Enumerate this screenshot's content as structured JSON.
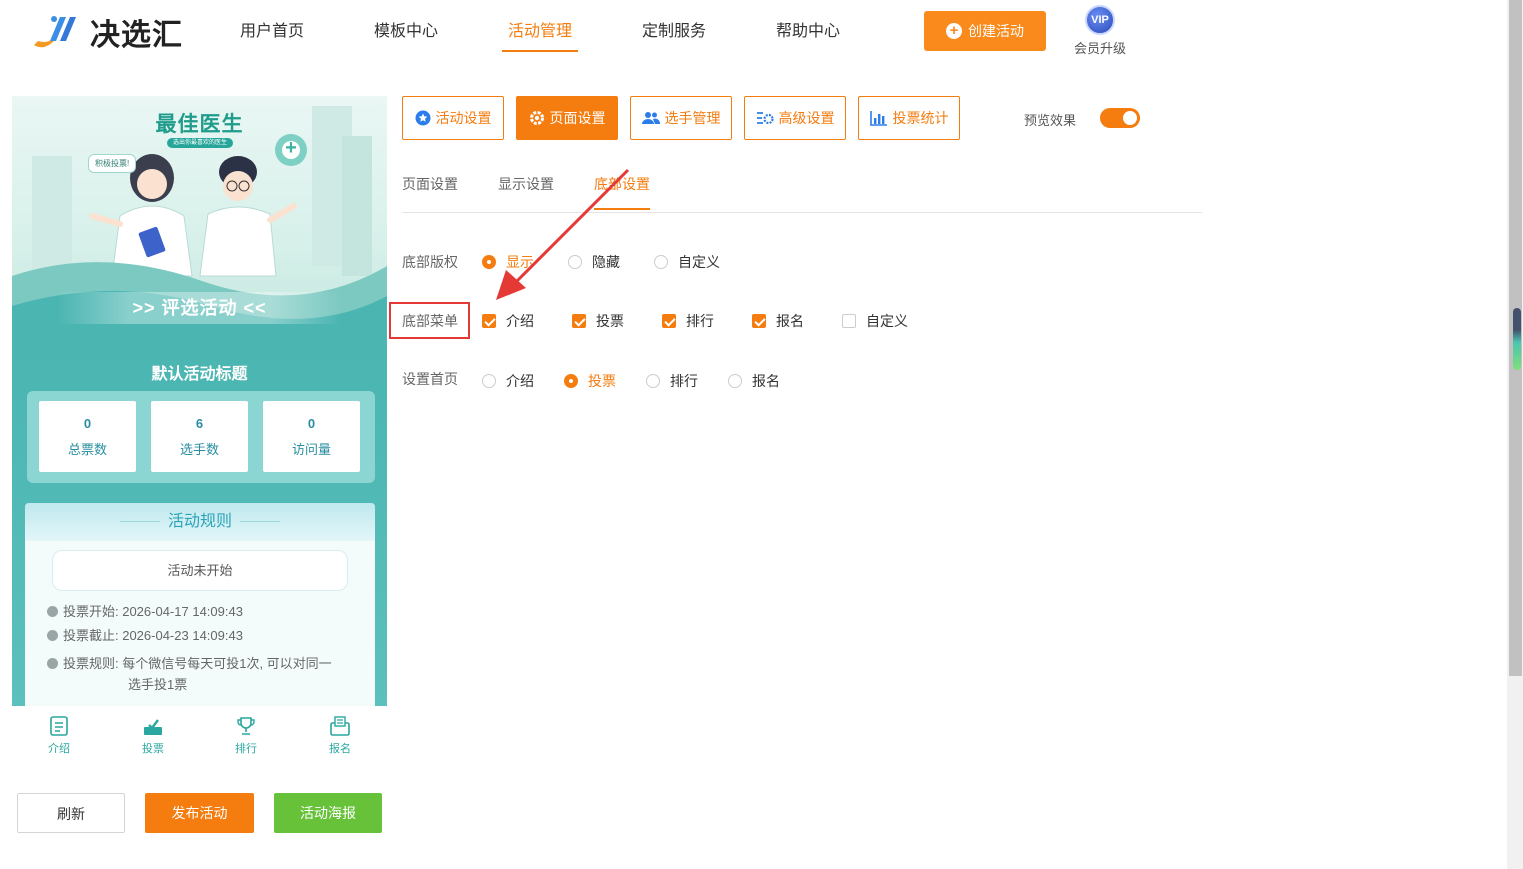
{
  "brand": {
    "name": "决选汇"
  },
  "nav": {
    "items": [
      "用户首页",
      "模板中心",
      "活动管理",
      "定制服务",
      "帮助中心"
    ],
    "active": "活动管理",
    "create_label": "创建活动",
    "vip_badge": "VIP",
    "vip_label": "会员升级"
  },
  "preview": {
    "banner_title": "最佳医生",
    "banner_sub": "选出你最喜欢的医生",
    "bubble": "积极投票!",
    "ribbon": ">> 评选活动 <<",
    "activity_title": "默认活动标题",
    "stats": [
      {
        "value": "0",
        "label": "总票数"
      },
      {
        "value": "6",
        "label": "选手数"
      },
      {
        "value": "0",
        "label": "访问量"
      }
    ],
    "rules_title": "活动规则",
    "status": "活动未开始",
    "vote_start": "投票开始: 2026-04-17 14:09:43",
    "vote_end": "投票截止: 2026-04-23 14:09:43",
    "vote_rule_1": "投票规则: 每个微信号每天可投1次, 可以对同一",
    "vote_rule_2": "选手投1票",
    "tabbar": [
      "介绍",
      "投票",
      "排行",
      "报名"
    ]
  },
  "actions": {
    "refresh": "刷新",
    "publish": "发布活动",
    "poster": "活动海报"
  },
  "settings": {
    "top_tabs": [
      "活动设置",
      "页面设置",
      "选手管理",
      "高级设置",
      "投票统计"
    ],
    "active_top_tab": "页面设置",
    "preview_label": "预览效果",
    "preview_on": true,
    "sub_tabs": [
      "页面设置",
      "显示设置",
      "底部设置"
    ],
    "active_sub_tab": "底部设置",
    "copyright": {
      "label": "底部版权",
      "options": [
        "显示",
        "隐藏",
        "自定义"
      ],
      "selected": "显示"
    },
    "menu": {
      "label": "底部菜单",
      "options": [
        "介绍",
        "投票",
        "排行",
        "报名",
        "自定义"
      ],
      "checked": [
        "介绍",
        "投票",
        "排行",
        "报名"
      ]
    },
    "home": {
      "label": "设置首页",
      "options": [
        "介绍",
        "投票",
        "排行",
        "报名"
      ],
      "selected": "投票"
    }
  },
  "colors": {
    "accent": "#f57c0f",
    "teal": "#4ab5b1",
    "green": "#67c23a",
    "annotation": "#e53935"
  }
}
